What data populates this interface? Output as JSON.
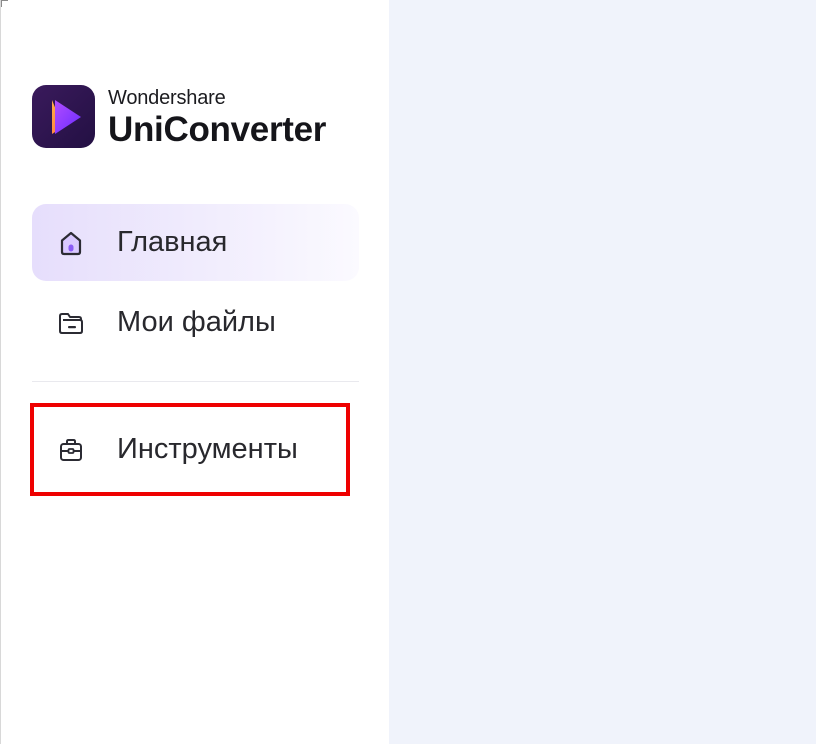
{
  "app": {
    "brand": "Wondershare",
    "product": "UniConverter",
    "logo_icon": "uniconverter-logo-icon"
  },
  "sidebar": {
    "items": [
      {
        "label": "Главная",
        "icon": "home-icon",
        "active": true
      },
      {
        "label": "Мои файлы",
        "icon": "folder-icon",
        "active": false
      },
      {
        "label": "Инструменты",
        "icon": "toolbox-icon",
        "active": false,
        "highlighted": true
      }
    ]
  },
  "colors": {
    "main_background": "#f0f3fb",
    "active_item_background": "#e6defc",
    "accent": "#8b5cf6",
    "highlight_border": "#ee0000",
    "logo_background": "#2d1550"
  }
}
